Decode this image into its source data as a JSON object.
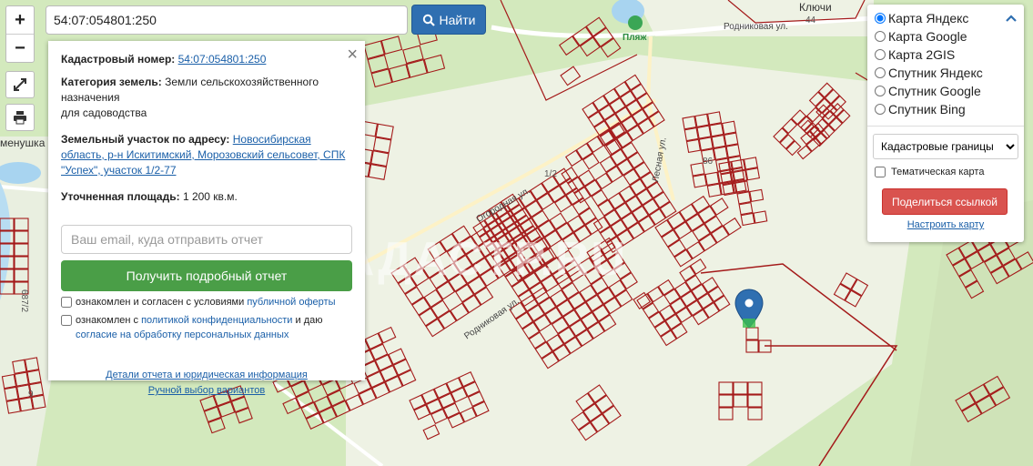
{
  "search": {
    "value": "54:07:054801:250",
    "button_label": "Найти"
  },
  "zoom": {
    "in_label": "+",
    "out_label": "−"
  },
  "tools": [
    "fullscreen-icon",
    "print-icon"
  ],
  "map_labels": {
    "klyuchi": "Ключи",
    "number_44": "44",
    "rodnikovaya": "Родниковая ул.",
    "beach": "Пляж",
    "menushka": "менушка",
    "lesnaya": "Лесная ул.",
    "plot_86": "86",
    "plot_1_2": "1/2",
    "plot_687_2": "687/2",
    "plot_9": "9",
    "ogorodnaya": "Огородная ул.",
    "rodnikovaya2": "Родниковая ул."
  },
  "info_panel": {
    "cadastral_label": "Кадастровый номер:",
    "cadastral_value": "54:07:054801:250",
    "category_label": "Категория земель:",
    "category_value": "Земли сельскохозяйственного назначения",
    "category_extra": "для садоводства",
    "address_label": "Земельный участок по адресу:",
    "address_value": "Новосибирская область, р-н Искитимский, Морозовский сельсовет, СПК \"Успех\", участок 1/2-77",
    "area_label": "Уточненная площадь:",
    "area_value": "1 200 кв.м.",
    "email_placeholder": "Ваш email, куда отправить отчет",
    "report_button": "Получить подробный отчет",
    "consent1_text": "ознакомлен и согласен с условиями ",
    "consent1_link": "публичной оферты",
    "consent2_text": "ознакомлен с ",
    "consent2_link": "политикой конфиденциальности",
    "consent2_mid": " и даю ",
    "consent2_link2": "согласие на обработку персональных данных",
    "details_link": "Детали отчета и юридическая информация",
    "manual_link": "Ручной выбор вариантов"
  },
  "watermark": "КАДАСТР.RU",
  "layers_panel": {
    "options": [
      "Карта Яндекс",
      "Карта Google",
      "Карта 2GIS",
      "Спутник Яндекс",
      "Спутник Google",
      "Спутник Bing"
    ],
    "selected": "Карта Яндекс",
    "overlay_select": "Кадастровые границы",
    "thematic_label": "Тематическая карта",
    "share_button": "Поделиться ссылкой",
    "config_link": "Настроить карту"
  },
  "colors": {
    "parcel_border": "#a41a1a",
    "forest": "#cfe6b5",
    "field": "#eef3e2",
    "accent_blue": "#2f6fb1",
    "report_green": "#4a9e47",
    "share_red": "#d9534f"
  }
}
